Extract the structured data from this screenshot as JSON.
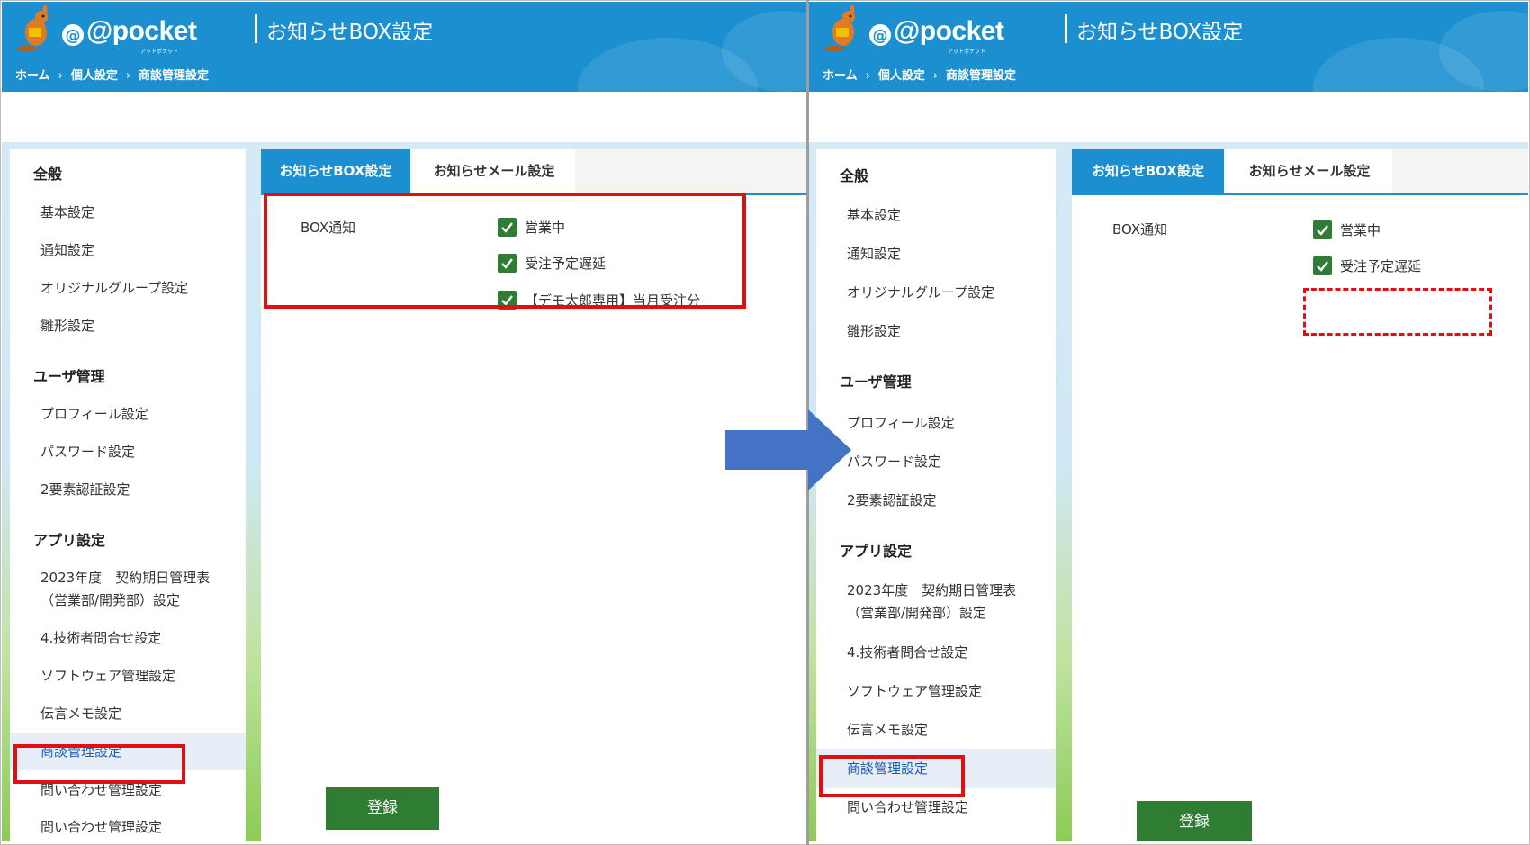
{
  "app": {
    "logo_text": "@pocket",
    "logo_subtext": "アットポケット"
  },
  "header": {
    "page_title": "お知らせBOX設定",
    "breadcrumb": [
      "ホーム",
      "個人設定",
      "商談管理設定"
    ],
    "breadcrumb_sep": "›"
  },
  "sidebar": {
    "general_heading": "全般",
    "general_items": [
      "基本設定",
      "通知設定",
      "オリジナルグループ設定",
      "雛形設定"
    ],
    "user_heading": "ユーザ管理",
    "user_items": [
      "プロフィール設定",
      "パスワード設定",
      "2要素認証設定"
    ],
    "app_heading": "アプリ設定",
    "app_item_multiline_1": "2023年度　契約期日管理表",
    "app_item_multiline_2": "（営業部/開発部）設定",
    "app_items": [
      "4.技術者問合せ設定",
      "ソフトウェア管理設定",
      "伝言メモ設定",
      "商談管理設定",
      "問い合わせ管理設定"
    ]
  },
  "tabs": {
    "box": "お知らせBOX設定",
    "mail": "お知らせメール設定"
  },
  "form": {
    "field_label": "BOX通知",
    "submit_label": "登録"
  },
  "before": {
    "checkboxes": [
      "営業中",
      "受注予定遅延",
      "【デモ太郎専用】当月受注分"
    ]
  },
  "after": {
    "checkboxes": [
      "営業中",
      "受注予定遅延"
    ]
  },
  "colors": {
    "header_blue": "#1b8fd0",
    "check_green": "#2e7d32",
    "highlight_red": "#e01010",
    "arrow_blue": "#4472c4",
    "active_link": "#1a5fb4"
  }
}
